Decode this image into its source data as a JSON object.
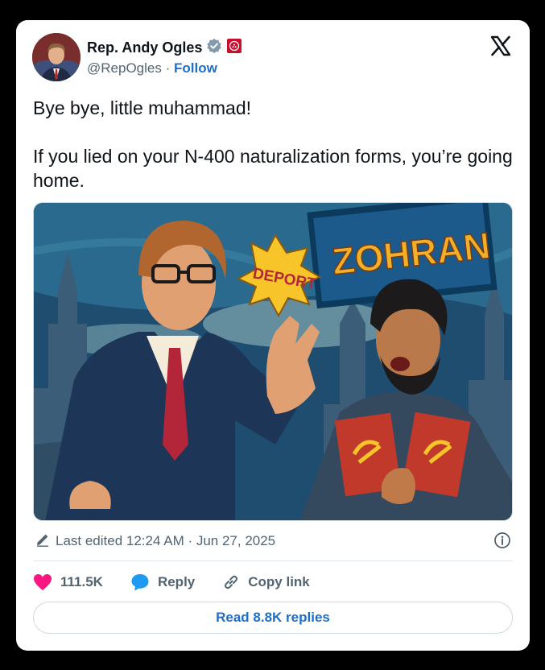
{
  "author": {
    "name": "Rep. Andy Ogles",
    "handle": "@RepOgles",
    "separator": "·",
    "follow_label": "Follow"
  },
  "tweet": {
    "text": "Bye bye, little muhammad!\n\nIf you lied on your N-400 naturalization forms, you’re going home."
  },
  "media": {
    "sign_text": "ZOHRAN",
    "burst_text": "DEPORT"
  },
  "meta": {
    "edited_label": "Last edited 12:24 AM · Jun 27, 2025"
  },
  "actions": {
    "likes": "111.5K",
    "reply_label": "Reply",
    "copy_label": "Copy link"
  },
  "read_replies_label": "Read 8.8K replies",
  "colors": {
    "like": "#f91880",
    "link": "#1d6fc7",
    "verified": "#829aab",
    "affiliate_badge": "#c8102e"
  },
  "icons": [
    "verified-badge-icon",
    "affiliation-badge-icon",
    "x-logo-icon",
    "pencil-icon",
    "info-icon",
    "heart-icon",
    "reply-bubble-icon",
    "link-icon"
  ]
}
